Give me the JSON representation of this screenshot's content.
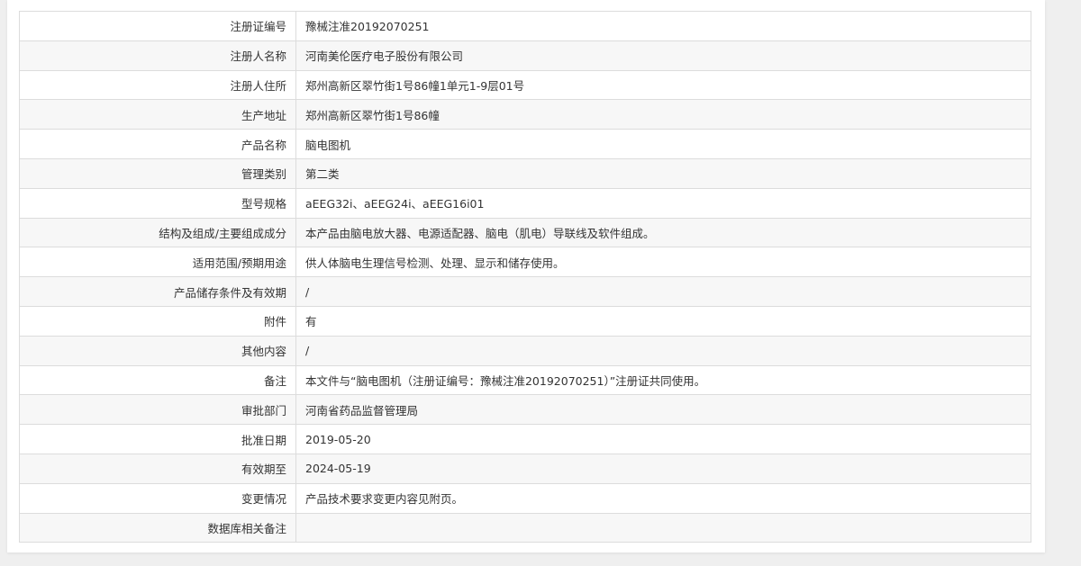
{
  "rows": [
    {
      "label": "注册证编号",
      "value": "豫械注准20192070251"
    },
    {
      "label": "注册人名称",
      "value": "河南美伦医疗电子股份有限公司"
    },
    {
      "label": "注册人住所",
      "value": "郑州高新区翠竹街1号86幢1单元1-9层01号"
    },
    {
      "label": "生产地址",
      "value": "郑州高新区翠竹街1号86幢"
    },
    {
      "label": "产品名称",
      "value": "脑电图机"
    },
    {
      "label": "管理类别",
      "value": "第二类"
    },
    {
      "label": "型号规格",
      "value": "aEEG32i、aEEG24i、aEEG16i01"
    },
    {
      "label": "结构及组成/主要组成成分",
      "value": "本产品由脑电放大器、电源适配器、脑电（肌电）导联线及软件组成。"
    },
    {
      "label": "适用范围/预期用途",
      "value": "供人体脑电生理信号检测、处理、显示和储存使用。"
    },
    {
      "label": "产品储存条件及有效期",
      "value": "/"
    },
    {
      "label": "附件",
      "value": "有"
    },
    {
      "label": "其他内容",
      "value": "/"
    },
    {
      "label": "备注",
      "value": "本文件与“脑电图机（注册证编号：豫械注准20192070251）”注册证共同使用。"
    },
    {
      "label": "审批部门",
      "value": "河南省药品监督管理局"
    },
    {
      "label": "批准日期",
      "value": "2019-05-20"
    },
    {
      "label": "有效期至",
      "value": "2024-05-19"
    },
    {
      "label": "变更情况",
      "value": "产品技术要求变更内容见附页。"
    },
    {
      "label": "数据库相关备注",
      "value": ""
    }
  ]
}
